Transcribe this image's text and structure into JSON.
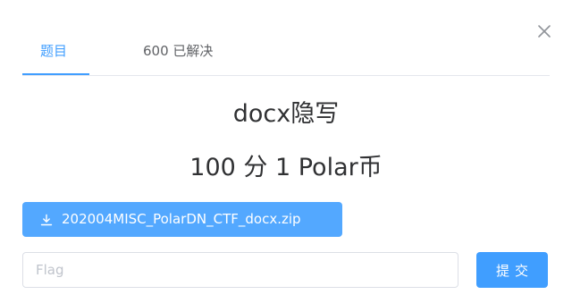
{
  "dialog": {
    "close_icon": "close-icon"
  },
  "tabs": [
    {
      "label": "题目",
      "active": true
    },
    {
      "label": "600 已解决",
      "active": false
    }
  ],
  "challenge": {
    "title": "docx隐写",
    "points": "100 分 1 Polar币"
  },
  "attachment": {
    "icon": "download-icon",
    "filename": "202004MISC_PolarDN_CTF_docx.zip"
  },
  "flag": {
    "value": "",
    "placeholder": "Flag"
  },
  "submit": {
    "label": "提交"
  },
  "colors": {
    "accent": "#409eff",
    "download_bg": "#53a8ff",
    "border": "#dcdfe6",
    "text": "#303133"
  }
}
